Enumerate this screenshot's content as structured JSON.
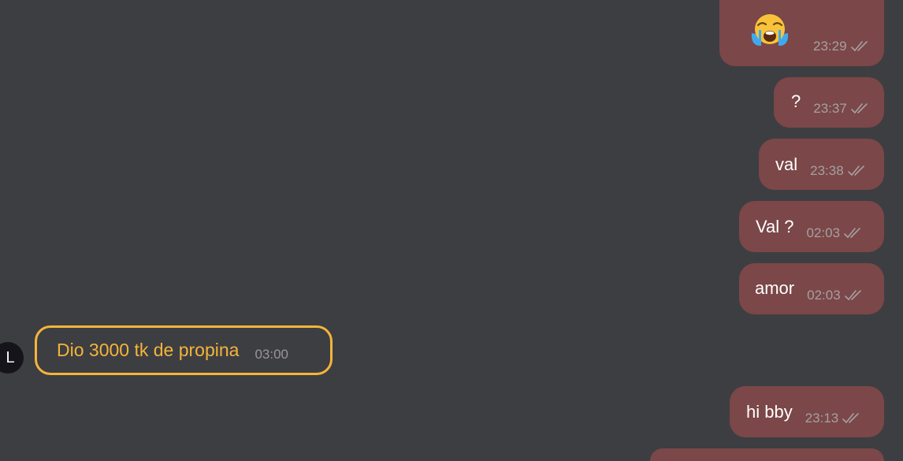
{
  "colors": {
    "background": "#3d3e42",
    "outgoing_bubble": "#7b4748",
    "incoming_accent": "#f5b43a",
    "meta_text": "#a5a0a2"
  },
  "messages": [
    {
      "direction": "outgoing",
      "emoji": "loudly-crying-face",
      "time": "23:29",
      "status": "read-double-tick"
    },
    {
      "direction": "outgoing",
      "text": "?",
      "time": "23:37",
      "status": "read-double-tick"
    },
    {
      "direction": "outgoing",
      "text": "val",
      "time": "23:38",
      "status": "read-double-tick"
    },
    {
      "direction": "outgoing",
      "text": "Val ?",
      "time": "02:03",
      "status": "read-double-tick"
    },
    {
      "direction": "outgoing",
      "text": "amor",
      "time": "02:03",
      "status": "read-double-tick"
    },
    {
      "direction": "incoming",
      "avatar_initial": "L",
      "text": "Dio 3000 tk de propina",
      "time": "03:00"
    },
    {
      "direction": "outgoing",
      "text": "hi bby",
      "time": "23:13",
      "status": "read-double-tick"
    }
  ]
}
